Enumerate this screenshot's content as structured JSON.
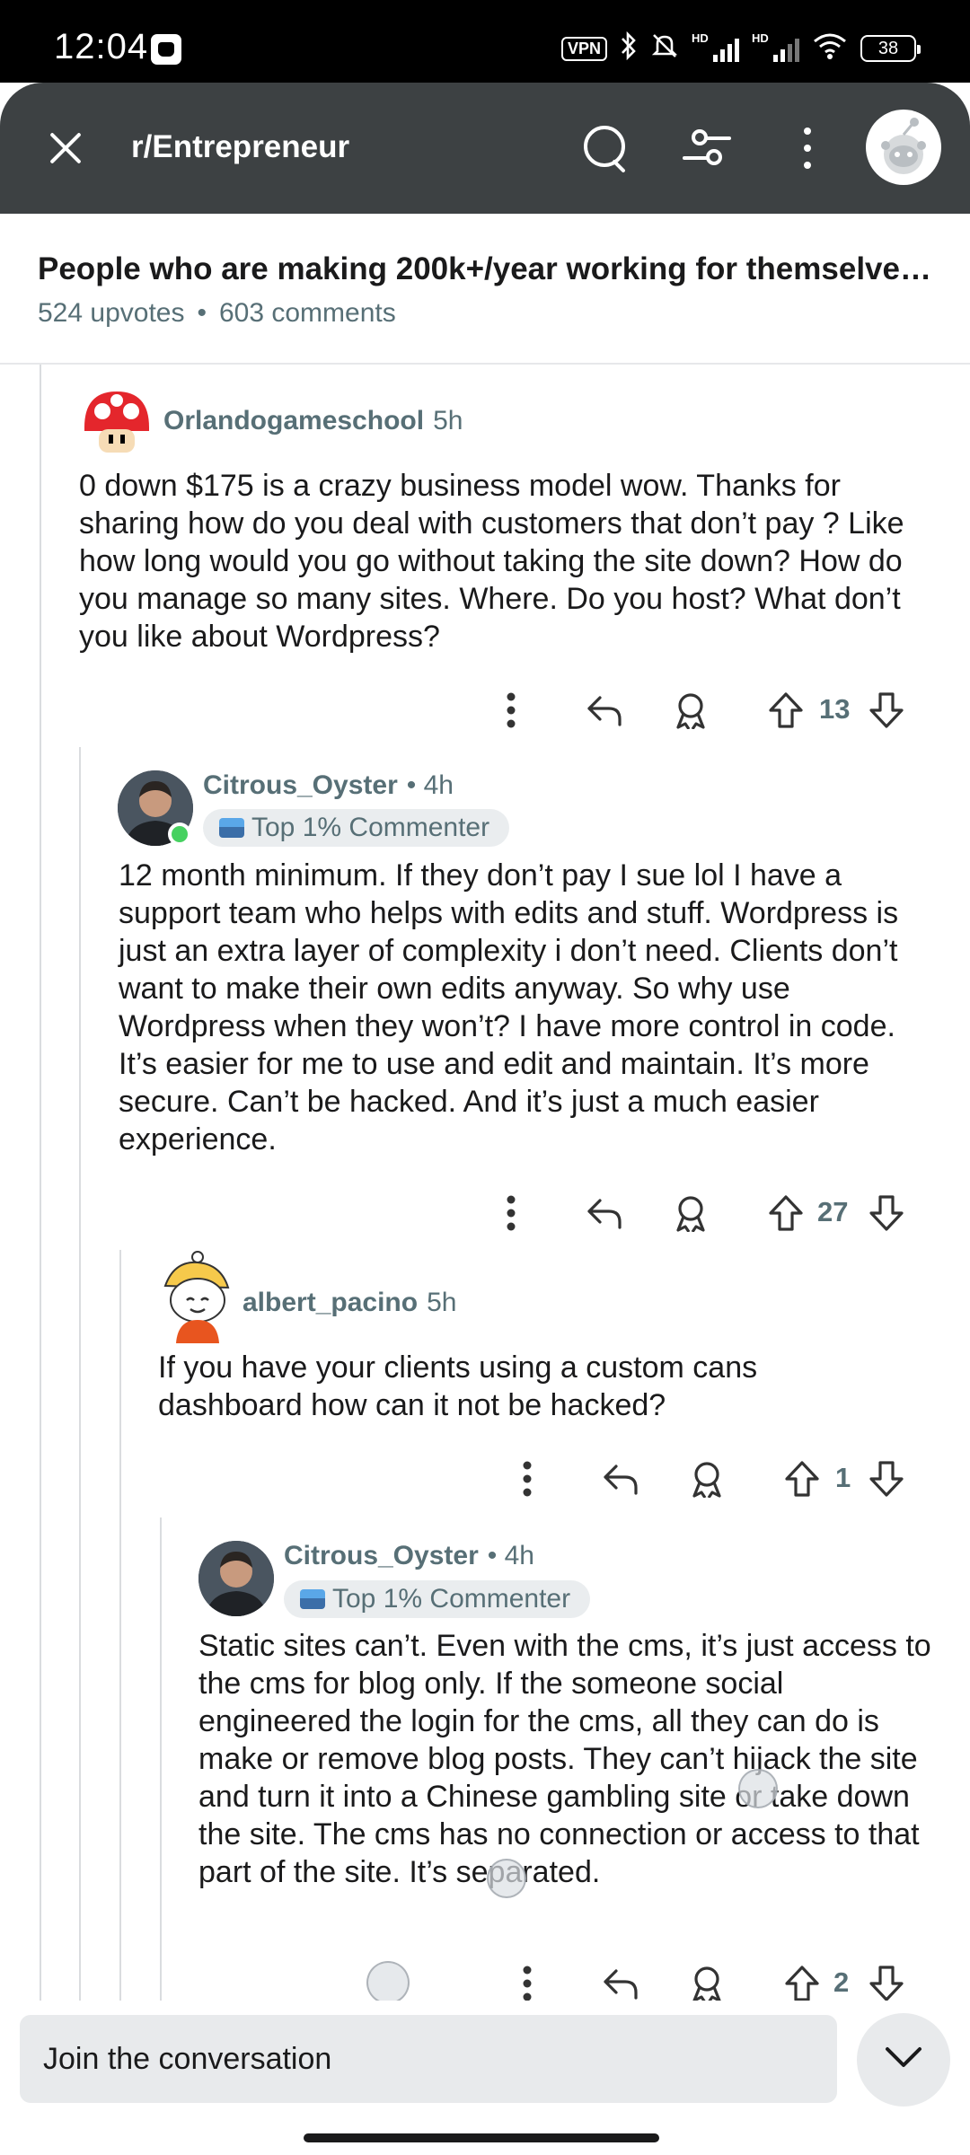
{
  "status_bar": {
    "time": "12:04",
    "vpn": "VPN",
    "hd1": "HD",
    "hd2": "HD",
    "battery": "38"
  },
  "header": {
    "subreddit": "r/Entrepreneur",
    "icons": [
      "close-icon",
      "search-icon",
      "filter-icon",
      "more-icon",
      "avatar"
    ]
  },
  "post": {
    "title": "People who are making 200k+/year working for themselves,...",
    "upvotes": "524 upvotes",
    "separator": "•",
    "comments": "603 comments"
  },
  "comments": [
    {
      "author": "Orlandogameschool",
      "time": "5h",
      "body": "0 down $175 is a crazy business model wow. Thanks for sharing how do you deal with customers that don’t pay ? Like how long would you go without taking the site down? How do you manage so many sites. Where. Do you host? What don’t you like about Wordpress?",
      "votes": "13"
    },
    {
      "author": "Citrous_Oyster",
      "time": "• 4h",
      "flair": "Top 1% Commenter",
      "body": "12 month minimum. If they don’t pay I sue lol I have a support team who helps with edits and stuff. Wordpress is just an extra layer of complexity i don’t need. Clients don’t want to make their own edits anyway. So why use Wordpress when they won’t? I have more control in code. It’s easier for me to use and edit and maintain. It’s more secure. Can’t be hacked. And it’s just a much easier experience.",
      "votes": "27"
    },
    {
      "author": "albert_pacino",
      "time": "5h",
      "body": "If you have your clients using a custom cans dashboard how can it not be hacked?",
      "votes": "1"
    },
    {
      "author": "Citrous_Oyster",
      "time": "• 4h",
      "flair": "Top 1% Commenter",
      "body": "Static sites can’t. Even with the cms, it’s just access to the cms for blog only. If the someone social engineered the login for the cms, all they can do is make or remove blog posts. They can’t hijack the site and turn it into a Chinese gambling site or take down the site. The cms has no connection or access to that part of the site. It’s separated.",
      "votes": "2"
    }
  ],
  "composer": {
    "placeholder": "Join the conversation"
  },
  "colors": {
    "header_bg": "#3d4143",
    "meta_text": "#576f76",
    "flair_bg": "#eaedef",
    "online": "#46d160",
    "thread_line": "#dadcdf"
  }
}
